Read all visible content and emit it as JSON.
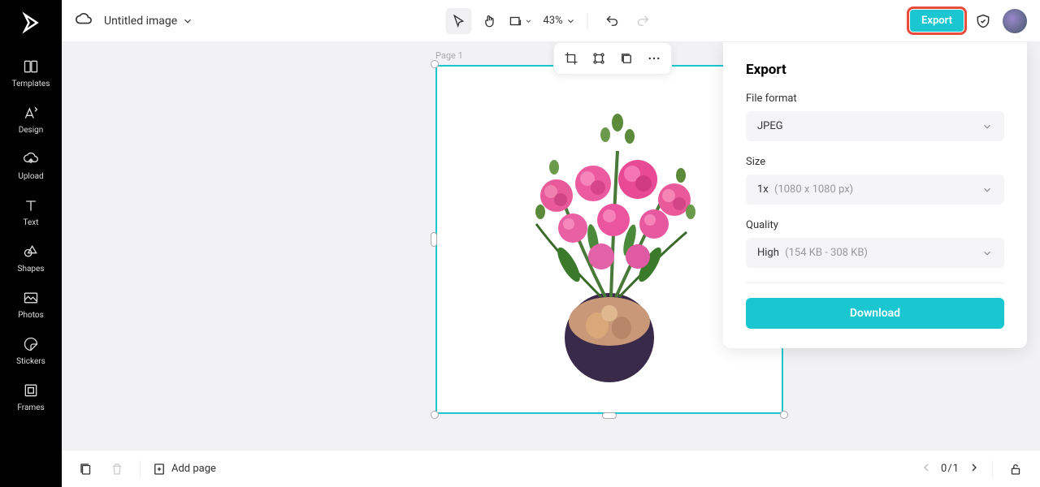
{
  "app": {
    "title": "Untitled image"
  },
  "rail": {
    "items": [
      {
        "label": "Templates",
        "icon": "templates"
      },
      {
        "label": "Design",
        "icon": "design"
      },
      {
        "label": "Upload",
        "icon": "upload"
      },
      {
        "label": "Text",
        "icon": "text"
      },
      {
        "label": "Shapes",
        "icon": "shapes"
      },
      {
        "label": "Photos",
        "icon": "photos"
      },
      {
        "label": "Stickers",
        "icon": "stickers"
      },
      {
        "label": "Frames",
        "icon": "frames"
      }
    ]
  },
  "topbar": {
    "zoom": "43%",
    "export_label": "Export"
  },
  "canvas": {
    "page_label": "Page 1"
  },
  "export_panel": {
    "title": "Export",
    "format_label": "File format",
    "format_value": "JPEG",
    "size_label": "Size",
    "size_value": "1x",
    "size_hint": "(1080 x 1080 px)",
    "quality_label": "Quality",
    "quality_value": "High",
    "quality_hint": "(154 KB - 308 KB)",
    "download_label": "Download"
  },
  "bottombar": {
    "add_page_label": "Add page",
    "page_counter": "0/1"
  }
}
